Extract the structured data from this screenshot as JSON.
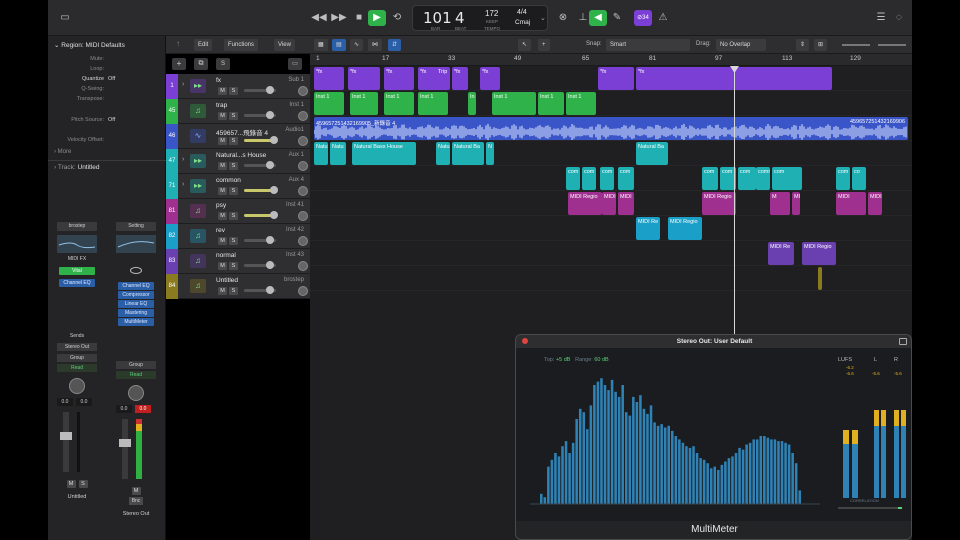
{
  "transport": {
    "rewind": "◀◀",
    "ff": "▶▶",
    "stop": "■",
    "play": "▶",
    "cycle": "⟲",
    "bar": "101",
    "beat": "4",
    "bar_label": "BAR",
    "beat_label": "BEAT",
    "tempo": "172",
    "tempo_mode": "KEEP",
    "tempo_label": "TEMPO",
    "signature": "4/4",
    "key": "Cmaj",
    "cpu_badge": "⊘34"
  },
  "inspector": {
    "region_header": "Region: MIDI Defaults",
    "rows": [
      {
        "key": "Mute:",
        "value": ""
      },
      {
        "key": "Loop:",
        "value": ""
      },
      {
        "key": "Quantize",
        "value": "Off"
      },
      {
        "key": "Q-Swing:",
        "value": ""
      },
      {
        "key": "Transpose:",
        "value": ""
      },
      {
        "key": "Pitch Source:",
        "value": "Off"
      },
      {
        "key": "Velocity Offset:",
        "value": ""
      }
    ],
    "more": "More",
    "track_header": "Track:",
    "track_name": "Untitled",
    "strip1": {
      "setting": "brostep",
      "midi_fx": "MIDI FX",
      "instrument": "Vital",
      "plugins": [
        "Channel EQ"
      ],
      "sends": "Sends",
      "output": "Stereo Out",
      "group": "Group",
      "automation": "Read",
      "volume": "0.0",
      "peak": "0.0",
      "m": "M",
      "s": "S",
      "name": "Untitled"
    },
    "strip2": {
      "setting": "Setting",
      "plugins": [
        "Channel EQ",
        "Compressor",
        "Linear EQ",
        "Mastering",
        "MultiMeter"
      ],
      "group": "Group",
      "automation": "Read",
      "volume": "0.0",
      "peak": "0.0",
      "m": "M",
      "bounce": "Bnc",
      "name": "Stereo Out"
    }
  },
  "toolbar": {
    "edit": "Edit",
    "functions": "Functions",
    "view": "View",
    "snap_label": "Snap:",
    "snap_value": "Smart",
    "drag_label": "Drag:",
    "drag_value": "No Overlap"
  },
  "ruler": [
    "1",
    "17",
    "33",
    "49",
    "65",
    "81",
    "97",
    "113",
    "129"
  ],
  "tracks": [
    {
      "num": "1",
      "name": "fx",
      "inst": "Sub 1",
      "color": "#7b3fd6",
      "icon": "folder-icon"
    },
    {
      "num": "45",
      "name": "trap",
      "inst": "Inst 1",
      "color": "#2fb24a",
      "icon": "instrument-icon"
    },
    {
      "num": "46",
      "name": "459657...飛錄音 4",
      "inst": "Audio1",
      "color": "#3a55c8",
      "icon": "waveform-icon"
    },
    {
      "num": "47",
      "name": "Natural...s House",
      "inst": "Aux 1",
      "color": "#1fb0b4",
      "icon": "folder-icon"
    },
    {
      "num": "71",
      "name": "common",
      "inst": "Aux 4",
      "color": "#1fb0b4",
      "icon": "folder-icon"
    },
    {
      "num": "81",
      "name": "psy",
      "inst": "Inst 41",
      "color": "#a0308f",
      "icon": "instrument-icon"
    },
    {
      "num": "82",
      "name": "rev",
      "inst": "Inst 42",
      "color": "#1a9fc8",
      "icon": "instrument-icon"
    },
    {
      "num": "83",
      "name": "normal",
      "inst": "Inst 43",
      "color": "#6a3fb0",
      "icon": "instrument-icon"
    },
    {
      "num": "84",
      "name": "Untitled",
      "inst": "brostep",
      "color": "#8a7a20",
      "icon": "instrument-icon"
    }
  ],
  "regions": {
    "fx": [
      "*fx",
      "*fx",
      "*fx",
      "*fx",
      "Trip",
      "*fx",
      "*fx",
      "*fx",
      "*fx"
    ],
    "trap": [
      "Inst 1",
      "Inst 1",
      "Inst 1",
      "Inst 1",
      "In",
      "Inst 1",
      "Inst 1",
      "Inst 1"
    ],
    "audio": "459657251432169905_新錄音 4",
    "audio_end": "459657251432169906",
    "natural": [
      "Natu",
      "Natu",
      "Natural Bass House",
      "Natu",
      "Natural Ba",
      "N",
      "Natural Ba"
    ],
    "common": [
      "com",
      "com",
      "com",
      "com",
      "com",
      "com",
      "com",
      "common",
      "com",
      "com",
      "co"
    ],
    "psy": [
      "MIDI Regio",
      "MIDI",
      "MIDI",
      "MIDI Regio",
      "M",
      "MIDI Regio",
      "MIDI",
      "MIDI"
    ],
    "rev": [
      "MIDI Re",
      "MIDI Regio"
    ],
    "normal": [
      "MIDI Re",
      "MIDI Regio"
    ]
  },
  "multimeter": {
    "title": "Stereo Out: User Default",
    "top_label": "Top:",
    "top_value": "+5 dB",
    "range_label": "Range:",
    "range_value": "60 dB",
    "lufs": "LUFS",
    "l": "L",
    "r": "R",
    "lufs_vals": [
      "-6.2",
      "-6.6"
    ],
    "l_val": "-5.6",
    "r_val": "-5.6",
    "footer": "MultiMeter",
    "correlation": "CORRELATION",
    "bars": [
      6,
      4,
      22,
      26,
      30,
      28,
      34,
      37,
      30,
      36,
      50,
      56,
      54,
      44,
      58,
      70,
      72,
      74,
      70,
      67,
      73,
      66,
      63,
      70,
      54,
      52,
      63,
      60,
      64,
      56,
      53,
      58,
      48,
      46,
      47,
      45,
      46,
      43,
      40,
      38,
      36,
      34,
      33,
      34,
      30,
      27,
      26,
      24,
      21,
      22,
      20,
      23,
      25,
      27,
      28,
      30,
      33,
      32,
      35,
      36,
      38,
      38,
      40,
      40,
      39,
      38,
      38,
      37,
      37,
      36,
      35,
      30,
      24,
      8
    ]
  },
  "colors": {
    "accent": "#2fb24a",
    "spectrum": "#2f82b5",
    "meter_yellow": "#e0b020"
  }
}
